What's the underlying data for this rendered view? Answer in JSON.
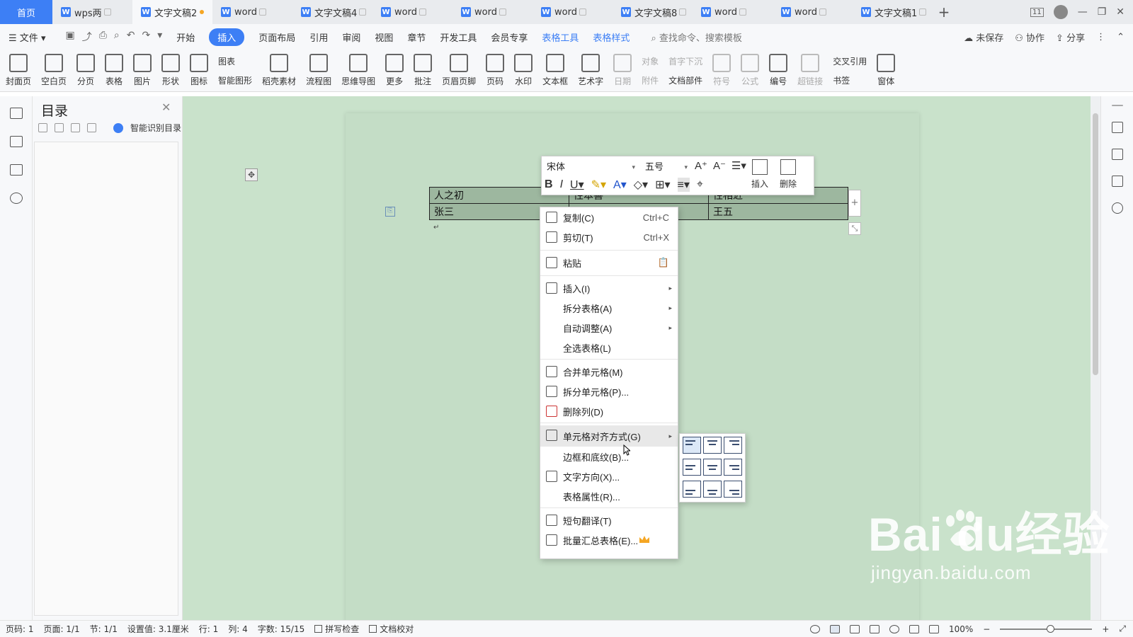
{
  "tabbar": {
    "home": "首页",
    "tabs": [
      {
        "label": "wps两",
        "active": false
      },
      {
        "label": "文字文稿2",
        "active": true,
        "modified": true
      },
      {
        "label": "word",
        "active": false
      },
      {
        "label": "文字文稿4",
        "active": false
      },
      {
        "label": "word",
        "active": false
      },
      {
        "label": "word",
        "active": false
      },
      {
        "label": "word",
        "active": false
      },
      {
        "label": "文字文稿8",
        "active": false
      },
      {
        "label": "word",
        "active": false
      },
      {
        "label": "word",
        "active": false
      },
      {
        "label": "文字文稿1",
        "active": false
      }
    ],
    "add": "+",
    "badge": "11"
  },
  "menubar": {
    "file": "文件",
    "items": [
      "开始",
      "插入",
      "页面布局",
      "引用",
      "审阅",
      "视图",
      "章节",
      "开发工具",
      "会员专享",
      "表格工具",
      "表格样式"
    ],
    "active": "插入",
    "search": "查找命令、搜索模板",
    "unsaved": "未保存",
    "collab": "协作",
    "share": "分享"
  },
  "ribbon": {
    "buttons": [
      "封面页",
      "空白页",
      "分页",
      "表格",
      "图片",
      "形状",
      "图标"
    ],
    "stack1": [
      "图表",
      "智能图形"
    ],
    "buttons2": [
      "稻壳素材",
      "流程图",
      "思维导图",
      "更多",
      "批注",
      "页眉页脚",
      "页码",
      "水印",
      "文本框",
      "艺术字",
      "日期"
    ],
    "stack2": [
      "对象",
      "附件"
    ],
    "stack3": [
      "首字下沉",
      "文档部件"
    ],
    "buttons3": [
      "符号",
      "公式",
      "编号",
      "超链接"
    ],
    "stack4": [
      "交叉引用",
      "书签"
    ],
    "buttons4": [
      "窗体"
    ]
  },
  "toc": {
    "title": "目录",
    "smart": "智能识别目录"
  },
  "table": {
    "rows": [
      [
        "人之初",
        "性本善",
        "性相近"
      ],
      [
        "张三",
        "",
        "王五"
      ]
    ]
  },
  "mini_toolbar": {
    "font": "宋体",
    "size": "五号",
    "insert": "插入",
    "delete": "删除"
  },
  "context_menu": {
    "copy": "复制(C)",
    "copy_sc": "Ctrl+C",
    "cut": "剪切(T)",
    "cut_sc": "Ctrl+X",
    "paste": "粘贴",
    "insert": "插入(I)",
    "split_table": "拆分表格(A)",
    "autofit": "自动调整(A)",
    "select_table": "全选表格(L)",
    "merge": "合并单元格(M)",
    "split_cells": "拆分单元格(P)...",
    "delete_col": "删除列(D)",
    "cell_align": "单元格对齐方式(G)",
    "borders": "边框和底纹(B)...",
    "text_dir": "文字方向(X)...",
    "table_props": "表格属性(R)...",
    "translate": "短句翻译(T)",
    "batch": "批量汇总表格(E)..."
  },
  "statusbar": {
    "page": "页码: 1",
    "pages": "页面: 1/1",
    "section": "节: 1/1",
    "setting": "设置值: 3.1厘米",
    "row": "行: 1",
    "col": "列: 4",
    "words": "字数: 15/15",
    "spell": "拼写检查",
    "proof": "文档校对",
    "zoom": "100%"
  },
  "watermark": {
    "brand": "Bai  du经验",
    "url": "jingyan.baidu.com"
  }
}
